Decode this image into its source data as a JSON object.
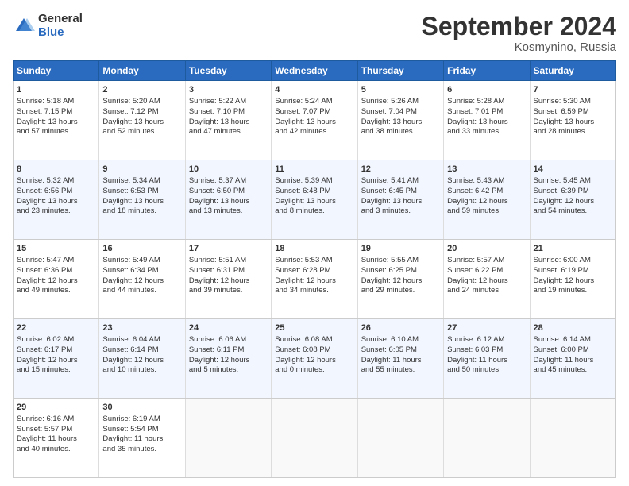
{
  "logo": {
    "general": "General",
    "blue": "Blue"
  },
  "title": "September 2024",
  "location": "Kosmynino, Russia",
  "days_header": [
    "Sunday",
    "Monday",
    "Tuesday",
    "Wednesday",
    "Thursday",
    "Friday",
    "Saturday"
  ],
  "weeks": [
    [
      {
        "day": "1",
        "lines": [
          "Sunrise: 5:18 AM",
          "Sunset: 7:15 PM",
          "Daylight: 13 hours",
          "and 57 minutes."
        ]
      },
      {
        "day": "2",
        "lines": [
          "Sunrise: 5:20 AM",
          "Sunset: 7:12 PM",
          "Daylight: 13 hours",
          "and 52 minutes."
        ]
      },
      {
        "day": "3",
        "lines": [
          "Sunrise: 5:22 AM",
          "Sunset: 7:10 PM",
          "Daylight: 13 hours",
          "and 47 minutes."
        ]
      },
      {
        "day": "4",
        "lines": [
          "Sunrise: 5:24 AM",
          "Sunset: 7:07 PM",
          "Daylight: 13 hours",
          "and 42 minutes."
        ]
      },
      {
        "day": "5",
        "lines": [
          "Sunrise: 5:26 AM",
          "Sunset: 7:04 PM",
          "Daylight: 13 hours",
          "and 38 minutes."
        ]
      },
      {
        "day": "6",
        "lines": [
          "Sunrise: 5:28 AM",
          "Sunset: 7:01 PM",
          "Daylight: 13 hours",
          "and 33 minutes."
        ]
      },
      {
        "day": "7",
        "lines": [
          "Sunrise: 5:30 AM",
          "Sunset: 6:59 PM",
          "Daylight: 13 hours",
          "and 28 minutes."
        ]
      }
    ],
    [
      {
        "day": "8",
        "lines": [
          "Sunrise: 5:32 AM",
          "Sunset: 6:56 PM",
          "Daylight: 13 hours",
          "and 23 minutes."
        ]
      },
      {
        "day": "9",
        "lines": [
          "Sunrise: 5:34 AM",
          "Sunset: 6:53 PM",
          "Daylight: 13 hours",
          "and 18 minutes."
        ]
      },
      {
        "day": "10",
        "lines": [
          "Sunrise: 5:37 AM",
          "Sunset: 6:50 PM",
          "Daylight: 13 hours",
          "and 13 minutes."
        ]
      },
      {
        "day": "11",
        "lines": [
          "Sunrise: 5:39 AM",
          "Sunset: 6:48 PM",
          "Daylight: 13 hours",
          "and 8 minutes."
        ]
      },
      {
        "day": "12",
        "lines": [
          "Sunrise: 5:41 AM",
          "Sunset: 6:45 PM",
          "Daylight: 13 hours",
          "and 3 minutes."
        ]
      },
      {
        "day": "13",
        "lines": [
          "Sunrise: 5:43 AM",
          "Sunset: 6:42 PM",
          "Daylight: 12 hours",
          "and 59 minutes."
        ]
      },
      {
        "day": "14",
        "lines": [
          "Sunrise: 5:45 AM",
          "Sunset: 6:39 PM",
          "Daylight: 12 hours",
          "and 54 minutes."
        ]
      }
    ],
    [
      {
        "day": "15",
        "lines": [
          "Sunrise: 5:47 AM",
          "Sunset: 6:36 PM",
          "Daylight: 12 hours",
          "and 49 minutes."
        ]
      },
      {
        "day": "16",
        "lines": [
          "Sunrise: 5:49 AM",
          "Sunset: 6:34 PM",
          "Daylight: 12 hours",
          "and 44 minutes."
        ]
      },
      {
        "day": "17",
        "lines": [
          "Sunrise: 5:51 AM",
          "Sunset: 6:31 PM",
          "Daylight: 12 hours",
          "and 39 minutes."
        ]
      },
      {
        "day": "18",
        "lines": [
          "Sunrise: 5:53 AM",
          "Sunset: 6:28 PM",
          "Daylight: 12 hours",
          "and 34 minutes."
        ]
      },
      {
        "day": "19",
        "lines": [
          "Sunrise: 5:55 AM",
          "Sunset: 6:25 PM",
          "Daylight: 12 hours",
          "and 29 minutes."
        ]
      },
      {
        "day": "20",
        "lines": [
          "Sunrise: 5:57 AM",
          "Sunset: 6:22 PM",
          "Daylight: 12 hours",
          "and 24 minutes."
        ]
      },
      {
        "day": "21",
        "lines": [
          "Sunrise: 6:00 AM",
          "Sunset: 6:19 PM",
          "Daylight: 12 hours",
          "and 19 minutes."
        ]
      }
    ],
    [
      {
        "day": "22",
        "lines": [
          "Sunrise: 6:02 AM",
          "Sunset: 6:17 PM",
          "Daylight: 12 hours",
          "and 15 minutes."
        ]
      },
      {
        "day": "23",
        "lines": [
          "Sunrise: 6:04 AM",
          "Sunset: 6:14 PM",
          "Daylight: 12 hours",
          "and 10 minutes."
        ]
      },
      {
        "day": "24",
        "lines": [
          "Sunrise: 6:06 AM",
          "Sunset: 6:11 PM",
          "Daylight: 12 hours",
          "and 5 minutes."
        ]
      },
      {
        "day": "25",
        "lines": [
          "Sunrise: 6:08 AM",
          "Sunset: 6:08 PM",
          "Daylight: 12 hours",
          "and 0 minutes."
        ]
      },
      {
        "day": "26",
        "lines": [
          "Sunrise: 6:10 AM",
          "Sunset: 6:05 PM",
          "Daylight: 11 hours",
          "and 55 minutes."
        ]
      },
      {
        "day": "27",
        "lines": [
          "Sunrise: 6:12 AM",
          "Sunset: 6:03 PM",
          "Daylight: 11 hours",
          "and 50 minutes."
        ]
      },
      {
        "day": "28",
        "lines": [
          "Sunrise: 6:14 AM",
          "Sunset: 6:00 PM",
          "Daylight: 11 hours",
          "and 45 minutes."
        ]
      }
    ],
    [
      {
        "day": "29",
        "lines": [
          "Sunrise: 6:16 AM",
          "Sunset: 5:57 PM",
          "Daylight: 11 hours",
          "and 40 minutes."
        ]
      },
      {
        "day": "30",
        "lines": [
          "Sunrise: 6:19 AM",
          "Sunset: 5:54 PM",
          "Daylight: 11 hours",
          "and 35 minutes."
        ]
      },
      {
        "day": "",
        "lines": []
      },
      {
        "day": "",
        "lines": []
      },
      {
        "day": "",
        "lines": []
      },
      {
        "day": "",
        "lines": []
      },
      {
        "day": "",
        "lines": []
      }
    ]
  ]
}
